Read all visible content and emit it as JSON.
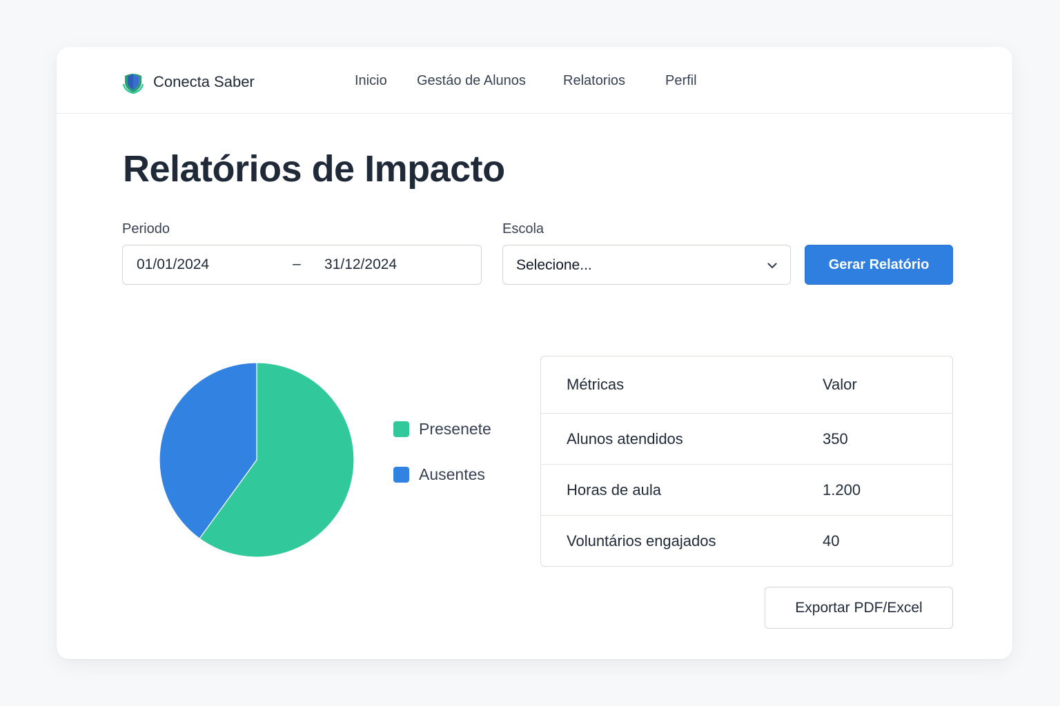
{
  "header": {
    "brand_name": "Conecta Saber",
    "nav": [
      "Inicio",
      "Gestáo de Alunos",
      "Relatorios",
      "Perfil"
    ]
  },
  "page": {
    "title": "Relatórios de Impacto"
  },
  "filters": {
    "period_label": "Periodo",
    "date_start": "01/01/2024",
    "date_separator": "–",
    "date_end": "31/12/2024",
    "school_label": "Escola",
    "school_value": "Selecione...",
    "generate_button": "Gerar Relatório"
  },
  "chart_data": {
    "type": "pie",
    "slices": [
      {
        "label": "Presenete",
        "value": 60,
        "color": "#31c89c"
      },
      {
        "label": "Ausentes",
        "value": 40,
        "color": "#3282e2"
      }
    ],
    "legend": "right"
  },
  "metrics_table": {
    "headers": [
      "Métricas",
      "Valor"
    ],
    "rows": [
      [
        "Alunos atendidos",
        "350"
      ],
      [
        "Horas de aula",
        "1.200"
      ],
      [
        "Voluntários engajados",
        "40"
      ]
    ]
  },
  "export_button": "Exportar PDF/Excel",
  "colors": {
    "accent": "#2f7fe0",
    "present": "#31c89c",
    "absent": "#3282e2"
  }
}
